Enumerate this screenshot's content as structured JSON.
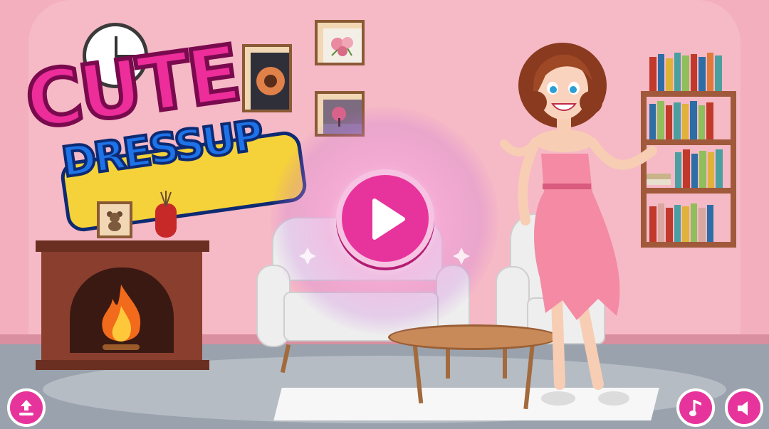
{
  "game": {
    "logo_line1": "CUTE",
    "logo_line2": "DRESSUP"
  },
  "buttons": {
    "play": "play-icon",
    "share": "upload-icon",
    "music": "music-note-icon",
    "sound": "speaker-icon"
  },
  "colors": {
    "brand_pink": "#e7349c",
    "logo_blue": "#1e73e8",
    "wall": "#f3afbd"
  }
}
